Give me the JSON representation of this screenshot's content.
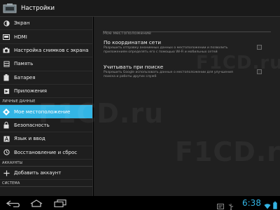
{
  "actionbar": {
    "title": "Настройки"
  },
  "sidebar": {
    "items_top": [
      {
        "label": "Экран",
        "icon": "display-icon"
      },
      {
        "label": "HDMI",
        "icon": "hdmi-icon"
      },
      {
        "label": "Настройка снимков с экрана",
        "icon": "camera-icon"
      },
      {
        "label": "Память",
        "icon": "storage-icon"
      },
      {
        "label": "Батарея",
        "icon": "battery-icon"
      },
      {
        "label": "Приложения",
        "icon": "apps-icon"
      }
    ],
    "section_personal": "ЛИЧНЫЕ ДАННЫЕ",
    "items_personal": [
      {
        "label": "Мое местоположение",
        "icon": "location-icon",
        "selected": true
      },
      {
        "label": "Безопасность",
        "icon": "lock-icon"
      },
      {
        "label": "Язык и ввод",
        "icon": "language-icon"
      },
      {
        "label": "Восстановление и сброс",
        "icon": "reset-icon"
      }
    ],
    "section_accounts": "АККАУНТЫ",
    "add_account": "Добавить аккаунт",
    "section_system": "СИСТЕМА"
  },
  "content": {
    "header": "Мое местоположение",
    "prefs": [
      {
        "title": "По координатам сети",
        "summary": "Разрешить отправку анонимных данных о местоположении и позволить приложениям определять его с помощью Wi-Fi и мобильных сетей",
        "checked": false
      },
      {
        "title": "Учитывать при поиске",
        "summary": "Разрешить Google использовать данные о местоположении для улучшения поиска и работы других служб",
        "checked": false
      }
    ]
  },
  "statusbar": {
    "time": "6:38"
  },
  "watermark": "F1CD.ru",
  "colors": {
    "accent": "#33b5e5",
    "selected_bg": "#33b5e5",
    "background": "#202020",
    "sidebar_bg": "#1e1e1e"
  }
}
